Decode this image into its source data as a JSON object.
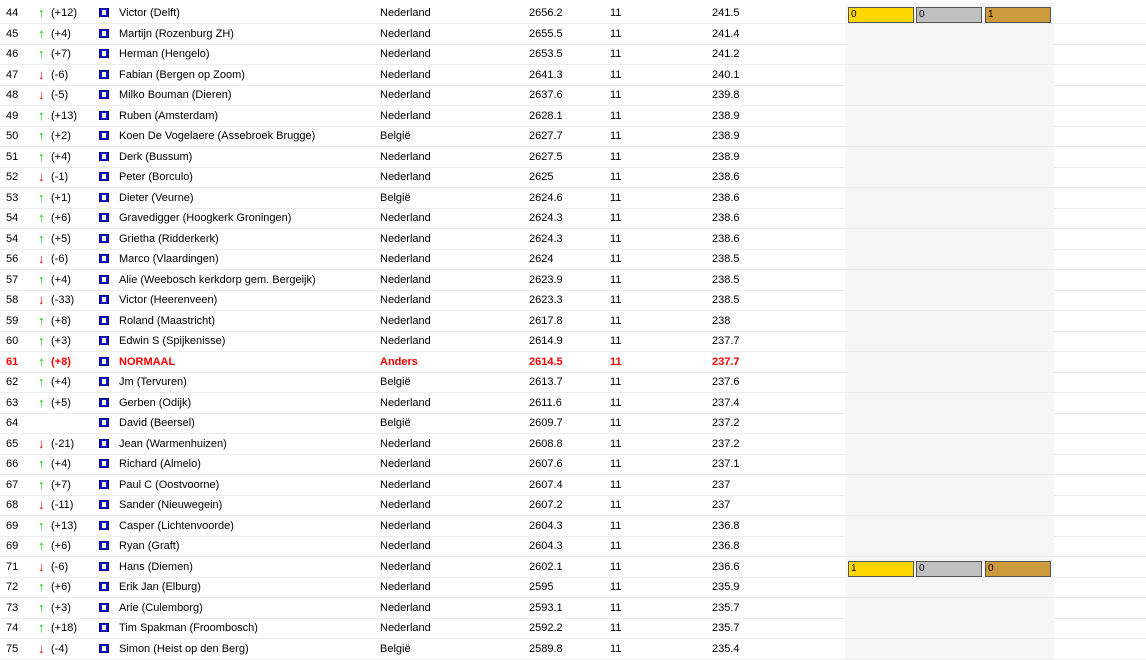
{
  "rows": [
    {
      "rank": "44",
      "dir": "up",
      "change": "(+12)",
      "name": "Victor (Delft)",
      "country": "Nederland",
      "rating": "2656.2",
      "games": "11",
      "avg": "241.5",
      "medals": [
        "0",
        "0",
        "1"
      ]
    },
    {
      "rank": "45",
      "dir": "up",
      "change": "(+4)",
      "name": "Martijn (Rozenburg ZH)",
      "country": "Nederland",
      "rating": "2655.5",
      "games": "11",
      "avg": "241.4"
    },
    {
      "rank": "46",
      "dir": "up",
      "change": "(+7)",
      "name": "Herman (Hengelo)",
      "country": "Nederland",
      "rating": "2653.5",
      "games": "11",
      "avg": "241.2"
    },
    {
      "rank": "47",
      "dir": "down",
      "change": "(-6)",
      "name": "Fabian (Bergen op Zoom)",
      "country": "Nederland",
      "rating": "2641.3",
      "games": "11",
      "avg": "240.1"
    },
    {
      "rank": "48",
      "dir": "down",
      "change": "(-5)",
      "name": "Milko Bouman (Dieren)",
      "country": "Nederland",
      "rating": "2637.6",
      "games": "11",
      "avg": "239.8"
    },
    {
      "rank": "49",
      "dir": "up",
      "change": "(+13)",
      "name": "Ruben (Amsterdam)",
      "country": "Nederland",
      "rating": "2628.1",
      "games": "11",
      "avg": "238.9"
    },
    {
      "rank": "50",
      "dir": "up",
      "change": "(+2)",
      "name": "Koen De Vogelaere (Assebroek Brugge)",
      "country": "België",
      "rating": "2627.7",
      "games": "11",
      "avg": "238.9"
    },
    {
      "rank": "51",
      "dir": "up",
      "change": "(+4)",
      "name": "Derk (Bussum)",
      "country": "Nederland",
      "rating": "2627.5",
      "games": "11",
      "avg": "238.9"
    },
    {
      "rank": "52",
      "dir": "down",
      "change": "(-1)",
      "name": "Peter (Borculo)",
      "country": "Nederland",
      "rating": "2625",
      "games": "11",
      "avg": "238.6"
    },
    {
      "rank": "53",
      "dir": "up",
      "change": "(+1)",
      "name": "Dieter (Veurne)",
      "country": "België",
      "rating": "2624.6",
      "games": "11",
      "avg": "238.6"
    },
    {
      "rank": "54",
      "dir": "up",
      "change": "(+6)",
      "name": "Gravedigger (Hoogkerk Groningen)",
      "country": "Nederland",
      "rating": "2624.3",
      "games": "11",
      "avg": "238.6"
    },
    {
      "rank": "54",
      "dir": "up",
      "change": "(+5)",
      "name": "Grietha (Ridderkerk)",
      "country": "Nederland",
      "rating": "2624.3",
      "games": "11",
      "avg": "238.6"
    },
    {
      "rank": "56",
      "dir": "down",
      "change": "(-6)",
      "name": "Marco (Vlaardingen)",
      "country": "Nederland",
      "rating": "2624",
      "games": "11",
      "avg": "238.5"
    },
    {
      "rank": "57",
      "dir": "up",
      "change": "(+4)",
      "name": "Alie (Weebosch kerkdorp gem. Bergeijk)",
      "country": "Nederland",
      "rating": "2623.9",
      "games": "11",
      "avg": "238.5"
    },
    {
      "rank": "58",
      "dir": "down",
      "change": "(-33)",
      "name": "Victor (Heerenveen)",
      "country": "Nederland",
      "rating": "2623.3",
      "games": "11",
      "avg": "238.5"
    },
    {
      "rank": "59",
      "dir": "up",
      "change": "(+8)",
      "name": "Roland (Maastricht)",
      "country": "Nederland",
      "rating": "2617.8",
      "games": "11",
      "avg": "238"
    },
    {
      "rank": "60",
      "dir": "up",
      "change": "(+3)",
      "name": "Edwin S (Spijkenisse)",
      "country": "Nederland",
      "rating": "2614.9",
      "games": "11",
      "avg": "237.7"
    },
    {
      "rank": "61",
      "dir": "up",
      "change": "(+8)",
      "name": "NORMAAL",
      "country": "Anders",
      "rating": "2614.5",
      "games": "11",
      "avg": "237.7",
      "highlight": true
    },
    {
      "rank": "62",
      "dir": "up",
      "change": "(+4)",
      "name": "Jm (Tervuren)",
      "country": "België",
      "rating": "2613.7",
      "games": "11",
      "avg": "237.6"
    },
    {
      "rank": "63",
      "dir": "up",
      "change": "(+5)",
      "name": "Gerben (Odijk)",
      "country": "Nederland",
      "rating": "2611.6",
      "games": "11",
      "avg": "237.4"
    },
    {
      "rank": "64",
      "dir": "none",
      "change": "",
      "name": "David (Beersel)",
      "country": "België",
      "rating": "2609.7",
      "games": "11",
      "avg": "237.2"
    },
    {
      "rank": "65",
      "dir": "down",
      "change": "(-21)",
      "name": "Jean (Warmenhuizen)",
      "country": "Nederland",
      "rating": "2608.8",
      "games": "11",
      "avg": "237.2"
    },
    {
      "rank": "66",
      "dir": "up",
      "change": "(+4)",
      "name": "Richard (Almelo)",
      "country": "Nederland",
      "rating": "2607.6",
      "games": "11",
      "avg": "237.1"
    },
    {
      "rank": "67",
      "dir": "up",
      "change": "(+7)",
      "name": "Paul C (Oostvoorne)",
      "country": "Nederland",
      "rating": "2607.4",
      "games": "11",
      "avg": "237"
    },
    {
      "rank": "68",
      "dir": "down",
      "change": "(-11)",
      "name": "Sander (Nieuwegein)",
      "country": "Nederland",
      "rating": "2607.2",
      "games": "11",
      "avg": "237"
    },
    {
      "rank": "69",
      "dir": "up",
      "change": "(+13)",
      "name": "Casper (Lichtenvoorde)",
      "country": "Nederland",
      "rating": "2604.3",
      "games": "11",
      "avg": "236.8"
    },
    {
      "rank": "69",
      "dir": "up",
      "change": "(+6)",
      "name": "Ryan (Graft)",
      "country": "Nederland",
      "rating": "2604.3",
      "games": "11",
      "avg": "236.8"
    },
    {
      "rank": "71",
      "dir": "down",
      "change": "(-6)",
      "name": "Hans (Diemen)",
      "country": "Nederland",
      "rating": "2602.1",
      "games": "11",
      "avg": "236.6",
      "medals": [
        "1",
        "0",
        "0"
      ]
    },
    {
      "rank": "72",
      "dir": "up",
      "change": "(+6)",
      "name": "Erik Jan (Elburg)",
      "country": "Nederland",
      "rating": "2595",
      "games": "11",
      "avg": "235.9"
    },
    {
      "rank": "73",
      "dir": "up",
      "change": "(+3)",
      "name": "Arie (Culemborg)",
      "country": "Nederland",
      "rating": "2593.1",
      "games": "11",
      "avg": "235.7"
    },
    {
      "rank": "74",
      "dir": "up",
      "change": "(+18)",
      "name": "Tim Spakman (Froombosch)",
      "country": "Nederland",
      "rating": "2592.2",
      "games": "11",
      "avg": "235.7"
    },
    {
      "rank": "75",
      "dir": "down",
      "change": "(-4)",
      "name": "Simon (Heist op den Berg)",
      "country": "België",
      "rating": "2589.8",
      "games": "11",
      "avg": "235.4"
    }
  ],
  "icons": {
    "up": "up-arrow-icon",
    "down": "down-arrow-icon",
    "flag": "flag-icon"
  },
  "colors": {
    "highlight": "#ff0000",
    "up": "#00cc00",
    "down": "#dd0000",
    "gold": "#ffd700",
    "silver": "#c0c0c0",
    "bronze": "#cd9b3c"
  }
}
